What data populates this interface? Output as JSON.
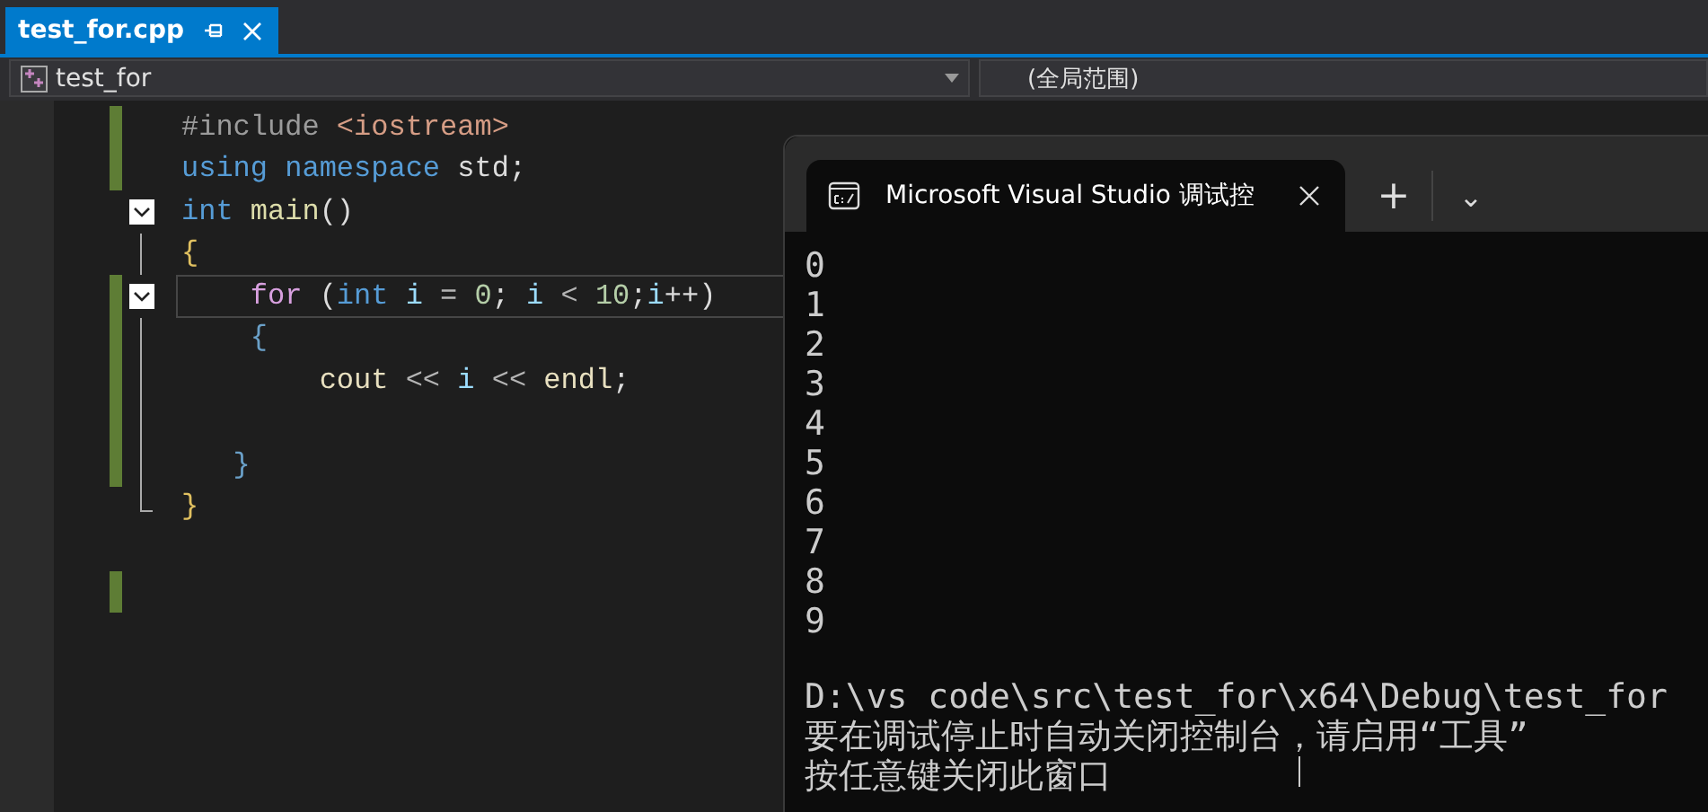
{
  "editor_tab": {
    "label": "test_for.cpp",
    "selected": true
  },
  "nav_bar": {
    "project": "test_for",
    "scope": "(全局范围)"
  },
  "code_lines": [
    {
      "changed": true,
      "kind": "plain",
      "current": false,
      "tokens": [
        {
          "text": "#include ",
          "kind": "preproc"
        },
        {
          "text": "<iostream>",
          "kind": "string"
        }
      ]
    },
    {
      "changed": true,
      "kind": "plain",
      "current": false,
      "tokens": [
        {
          "text": "using ",
          "kind": "keyword"
        },
        {
          "text": "namespace ",
          "kind": "keyword"
        },
        {
          "text": "std;",
          "kind": "plain"
        }
      ]
    },
    {
      "changed": false,
      "kind": "fold-start",
      "current": false,
      "tokens": [
        {
          "text": "int ",
          "kind": "keyword"
        },
        {
          "text": "main",
          "kind": "func"
        },
        {
          "text": "()",
          "kind": "plain"
        }
      ]
    },
    {
      "changed": false,
      "kind": "fold-body",
      "current": false,
      "tokens": [
        {
          "text": "{",
          "kind": "brace"
        }
      ]
    },
    {
      "changed": true,
      "kind": "fold-start",
      "current": true,
      "tokens": [
        {
          "text": "    for ",
          "kind": "control"
        },
        {
          "text": "(",
          "kind": "plain"
        },
        {
          "text": "int ",
          "kind": "keyword"
        },
        {
          "text": "i ",
          "kind": "variable"
        },
        {
          "text": "= ",
          "kind": "operator"
        },
        {
          "text": "0",
          "kind": "number"
        },
        {
          "text": "; ",
          "kind": "plain"
        },
        {
          "text": "i ",
          "kind": "variable"
        },
        {
          "text": "< ",
          "kind": "operator"
        },
        {
          "text": "10",
          "kind": "number"
        },
        {
          "text": ";",
          "kind": "plain"
        },
        {
          "text": "i",
          "kind": "variable"
        },
        {
          "text": "++)",
          "kind": "plain"
        }
      ]
    },
    {
      "changed": true,
      "kind": "fold-body",
      "current": false,
      "tokens": [
        {
          "text": "    {",
          "kind": "brace2"
        }
      ]
    },
    {
      "changed": true,
      "kind": "fold-body",
      "current": false,
      "tokens": [
        {
          "text": "        cout ",
          "kind": "ident"
        },
        {
          "text": "<< ",
          "kind": "operator"
        },
        {
          "text": "i ",
          "kind": "variable"
        },
        {
          "text": "<< ",
          "kind": "operator"
        },
        {
          "text": "endl",
          "kind": "ident"
        },
        {
          "text": ";",
          "kind": "plain"
        }
      ]
    },
    {
      "changed": true,
      "kind": "fold-body",
      "current": false
    },
    {
      "changed": true,
      "kind": "fold-body",
      "current": false,
      "tokens": [
        {
          "text": "   }",
          "kind": "brace2"
        }
      ]
    },
    {
      "changed": false,
      "kind": "fold-end",
      "current": false,
      "tokens": [
        {
          "text": "}",
          "kind": "brace"
        }
      ]
    },
    {
      "changed": false,
      "kind": "plain",
      "current": false
    },
    {
      "changed": true,
      "kind": "plain",
      "current": false
    }
  ],
  "console": {
    "tab_title": "Microsoft Visual Studio 调试控",
    "new_tab": "+",
    "dropdown": "⌄",
    "output": [
      "0",
      "1",
      "2",
      "3",
      "4",
      "5",
      "6",
      "7",
      "8",
      "9"
    ],
    "messages": [
      "D:\\vs code\\src\\test_for\\x64\\Debug\\test_for",
      "要在调试停止时自动关闭控制台，请启用“工具”",
      "按任意键关闭此窗口"
    ]
  }
}
